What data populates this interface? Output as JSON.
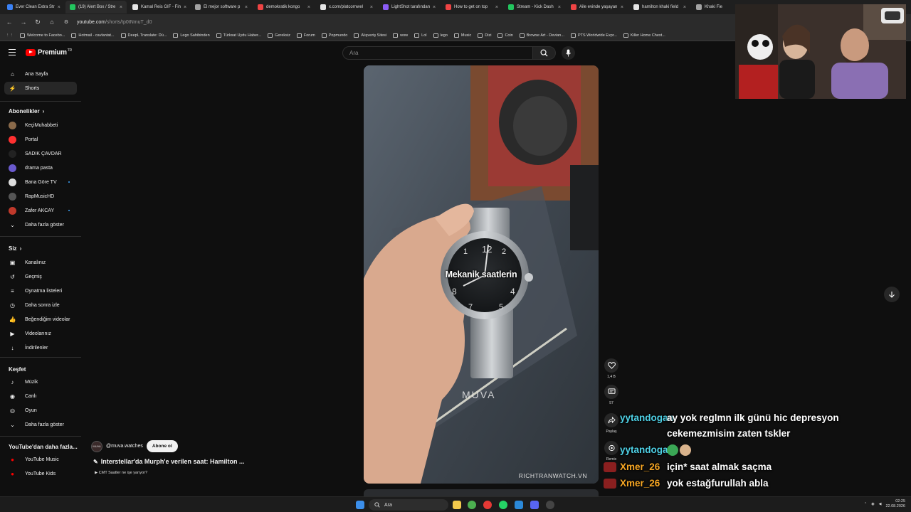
{
  "browser": {
    "tabs": [
      {
        "label": "Ever Clean Extra Str",
        "color": "#3b82f6"
      },
      {
        "label": "(19) Alert Box / Stre",
        "color": "#22c55e",
        "active": true
      },
      {
        "label": "Kamal Reis GIF - Fin",
        "color": "#e5e5e5"
      },
      {
        "label": "El mejor software p",
        "color": "#a3a3a3"
      },
      {
        "label": "demokratik kongo",
        "color": "#ef4444"
      },
      {
        "label": "x.com/platcornwel",
        "color": "#e5e5e5"
      },
      {
        "label": "LightShot tarafından",
        "color": "#8b5cf6"
      },
      {
        "label": "How to get on top",
        "color": "#ef4444"
      },
      {
        "label": "Stream - Kick Dash",
        "color": "#22c55e"
      },
      {
        "label": "Aile evinde yaşayan",
        "color": "#ef4444"
      },
      {
        "label": "hamilton khaki field",
        "color": "#e5e5e5"
      },
      {
        "label": "Khaki Fie",
        "color": "#a3a3a3"
      }
    ],
    "url_host": "youtube.com",
    "url_path": "/shorts/Ip0tNmuT_d0",
    "bookmarks": [
      "Welcome to Facebo...",
      "Hotmail - cavlantat...",
      "DeepL Translate: Dü...",
      "Lego Sahibinden",
      "Türksat Uydu Haber...",
      "Gereksiz",
      "Forum",
      "Popmundo",
      "Alışveriş Sitesi",
      "wow",
      "Lol",
      "lego",
      "Music",
      "Dizi",
      "Coin",
      "Browse Art - Devian...",
      "PTS Worldwide Expr...",
      "Killer Home Chest..."
    ]
  },
  "youtube": {
    "logo_text": "Premium",
    "logo_sup": "TR",
    "search_placeholder": "Ara",
    "sidebar": {
      "main": [
        {
          "label": "Ana Sayfa",
          "icon": "home-icon"
        },
        {
          "label": "Shorts",
          "icon": "shorts-icon",
          "active": true
        }
      ],
      "subs_header": "Abonelikler",
      "subs": [
        {
          "label": "KeçiMuhabbeti",
          "color": "#8a6a4a"
        },
        {
          "label": "Portal",
          "color": "#ff3030"
        },
        {
          "label": "SADIK ÇAVDAR",
          "color": "#222222"
        },
        {
          "label": "drama pasta",
          "color": "#6a5acd"
        },
        {
          "label": "Bana Göre TV",
          "color": "#dddddd",
          "dot": true
        },
        {
          "label": "RapMusicHD",
          "color": "#555555"
        },
        {
          "label": "Zafer AKCAY",
          "color": "#c0392b",
          "dot": true
        }
      ],
      "subs_more": "Daha fazla göster",
      "you_header": "Siz",
      "you": [
        {
          "label": "Kanalınız",
          "icon": "account-icon"
        },
        {
          "label": "Geçmiş",
          "icon": "history-icon"
        },
        {
          "label": "Oynatma listeleri",
          "icon": "playlist-icon"
        },
        {
          "label": "Daha sonra izle",
          "icon": "clock-icon"
        },
        {
          "label": "Beğendiğim videolar",
          "icon": "like-icon"
        },
        {
          "label": "Videolarınız",
          "icon": "video-icon"
        },
        {
          "label": "İndirilenler",
          "icon": "download-icon"
        }
      ],
      "explore_header": "Keşfet",
      "explore": [
        {
          "label": "Müzik",
          "icon": "music-icon"
        },
        {
          "label": "Canlı",
          "icon": "live-icon"
        },
        {
          "label": "Oyun",
          "icon": "gamepad-icon"
        }
      ],
      "explore_more": "Daha fazla göster",
      "more_header": "YouTube'dan daha fazla...",
      "more": [
        {
          "label": "YouTube Music",
          "color": "#ff0000"
        },
        {
          "label": "YouTube Kids",
          "color": "#ff0000"
        }
      ]
    },
    "short": {
      "caption": "Mekanik saatlerin",
      "watermark": "RICHTRANWATCH.VN",
      "channel_avatar": "MUVA",
      "channel": "@muva.watches",
      "subscribe": "Abone ol",
      "title": "Interstellar'da Murph'e verilen saat: Hamilton ...",
      "suggestion": "CMT Saatler ne işe yarıyor?",
      "likes": "1,4 B",
      "comments": "57",
      "share": "Paylaş",
      "remix": "Remix"
    }
  },
  "chat": [
    {
      "user": "yytandogan",
      "color": "#4fd1e6",
      "msg": "ay yok reglmn ilk günü hic depresyon"
    },
    {
      "user": "",
      "color": "#4fd1e6",
      "msg": "cekemezmisim zaten tskler"
    },
    {
      "user": "yytandogan",
      "color": "#4fd1e6",
      "msg": ""
    },
    {
      "user": "Xmer_26",
      "color": "#f6a623",
      "msg": "için* saat almak saçma"
    },
    {
      "user": "Xmer_26",
      "color": "#f6a623",
      "msg": "yok estağfurullah abla"
    }
  ],
  "taskbar": {
    "search_label": "Ara",
    "time": "02:25",
    "date": "22.08.2026"
  }
}
